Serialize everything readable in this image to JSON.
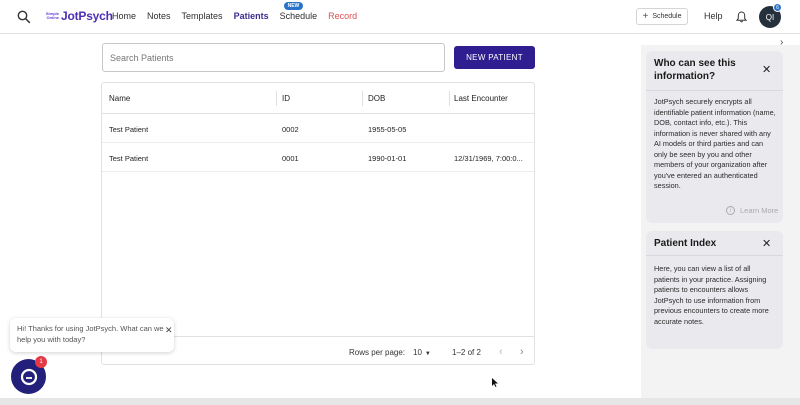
{
  "header": {
    "logo_small": "Simple Online",
    "logo_name": "JotPsych",
    "nav": [
      {
        "label": "Home"
      },
      {
        "label": "Notes"
      },
      {
        "label": "Templates"
      },
      {
        "label": "Patients"
      },
      {
        "label": "Schedule",
        "badge": "NEW"
      },
      {
        "label": "Record"
      }
    ],
    "schedule_button": "Schedule",
    "help": "Help",
    "avatar_initials": "QI",
    "avatar_badge": "6"
  },
  "main": {
    "search_placeholder": "Search Patients",
    "new_patient_button": "NEW PATIENT",
    "columns": [
      "Name",
      "ID",
      "DOB",
      "Last Encounter"
    ],
    "rows": [
      {
        "name": "Test Patient",
        "id": "0002",
        "dob": "1955-05-05",
        "last": ""
      },
      {
        "name": "Test Patient",
        "id": "0001",
        "dob": "1990-01-01",
        "last": "12/31/1969, 7:00:0..."
      }
    ],
    "rows_per_page_label": "Rows per page:",
    "rows_per_page_value": "10",
    "pagination_range": "1–2 of 2"
  },
  "panels": {
    "visibility": {
      "title": "Who can see this information?",
      "body": "JotPsych securely encrypts all identifiable patient information (name, DOB, contact info, etc.). This information is never shared with any AI models or third parties and can only be seen by you and other members of your organization after you've entered an authenticated session.",
      "learn_more": "Learn More"
    },
    "index": {
      "title": "Patient Index",
      "body": "Here, you can view a list of all patients in your practice. Assigning patients to encounters allows JotPsych to use information from previous encounters to create more accurate notes."
    }
  },
  "chat": {
    "message": "Hi! Thanks for using JotPsych. What can we help you with today?",
    "badge": "1"
  },
  "colors": {
    "brand": "#2e1e8f",
    "record": "#d9534f",
    "badge_blue": "#2a73c9"
  }
}
